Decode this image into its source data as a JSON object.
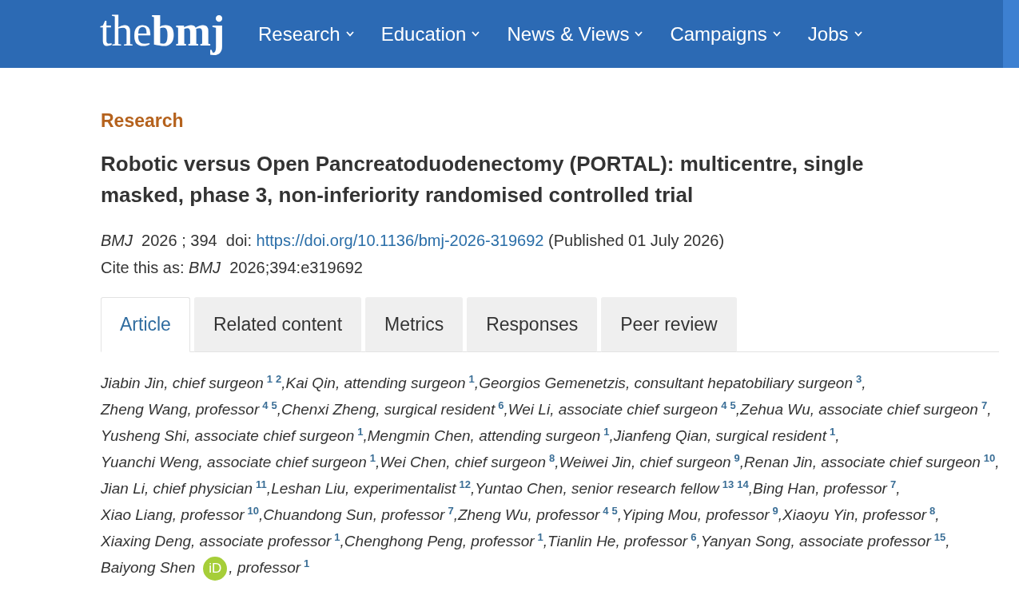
{
  "header": {
    "logo": "the**bmj**",
    "nav": [
      {
        "label": "Research"
      },
      {
        "label": "Education"
      },
      {
        "label": "News & Views"
      },
      {
        "label": "Campaigns"
      },
      {
        "label": "Jobs"
      }
    ]
  },
  "article": {
    "section": "Research",
    "title": "Robotic versus Open Pancreatoduodenectomy (PORTAL): multicentre, single masked, phase 3, non-inferiority randomised controlled trial",
    "citation": {
      "lead": "*BMJ*  2026 ; 394  doi: ",
      "doi_link": "https://doi.org/10.1136/bmj-2026-319692",
      "published": " (Published 01 July 2026)"
    },
    "cite_as": "Cite this as: *BMJ*  2026;394:e319692"
  },
  "tabs": [
    {
      "label": "Article",
      "selected": true
    },
    {
      "label": "Related content",
      "selected": false
    },
    {
      "label": "Metrics",
      "selected": false
    },
    {
      "label": "Responses",
      "selected": false
    },
    {
      "label": "Peer review",
      "selected": false
    }
  ],
  "authors": [
    {
      "name": "Jiabin Jin",
      "role": ", chief surgeon",
      "affiliations": [
        "1",
        "2"
      ],
      "separator": ","
    },
    {
      "name": "Kai Qin",
      "role": ", attending surgeon",
      "affiliations": [
        "1"
      ],
      "separator": ","
    },
    {
      "name": "Georgios Gemenetzis",
      "role": ", consultant hepatobiliary surgeon",
      "affiliations": [
        "3"
      ],
      "separator": ","
    },
    {
      "name": "Zheng Wang",
      "role": ", professor",
      "affiliations": [
        "4",
        "5"
      ],
      "separator": ","
    },
    {
      "name": "Chenxi Zheng",
      "role": ", surgical resident",
      "affiliations": [
        "6"
      ],
      "separator": ","
    },
    {
      "name": "Wei Li",
      "role": ", associate chief surgeon",
      "affiliations": [
        "4",
        "5"
      ],
      "separator": ","
    },
    {
      "name": "Zehua Wu",
      "role": ", associate chief surgeon",
      "affiliations": [
        "7"
      ],
      "separator": ","
    },
    {
      "name": "Yusheng Shi",
      "role": ", associate chief surgeon",
      "affiliations": [
        "1"
      ],
      "separator": ","
    },
    {
      "name": "Mengmin Chen",
      "role": ", attending surgeon",
      "affiliations": [
        "1"
      ],
      "separator": ","
    },
    {
      "name": "Jianfeng Qian",
      "role": ", surgical resident",
      "affiliations": [
        "1"
      ],
      "separator": ","
    },
    {
      "name": "Yuanchi Weng",
      "role": ", associate chief surgeon",
      "affiliations": [
        "1"
      ],
      "separator": ","
    },
    {
      "name": "Wei Chen",
      "role": ", chief surgeon",
      "affiliations": [
        "8"
      ],
      "separator": ","
    },
    {
      "name": "Weiwei Jin",
      "role": ", chief surgeon",
      "affiliations": [
        "9"
      ],
      "separator": ","
    },
    {
      "name": "Renan Jin",
      "role": ", associate chief surgeon",
      "affiliations": [
        "10"
      ],
      "separator": ","
    },
    {
      "name": "Jian Li",
      "role": ", chief physician",
      "affiliations": [
        "11"
      ],
      "separator": ","
    },
    {
      "name": "Leshan Liu",
      "role": ", experimentalist",
      "affiliations": [
        "12"
      ],
      "separator": ","
    },
    {
      "name": "Yuntao Chen",
      "role": ", senior research fellow",
      "affiliations": [
        "13",
        "14"
      ],
      "separator": ","
    },
    {
      "name": "Bing Han",
      "role": ", professor",
      "affiliations": [
        "7"
      ],
      "separator": ","
    },
    {
      "name": "Xiao Liang",
      "role": ", professor",
      "affiliations": [
        "10"
      ],
      "separator": ","
    },
    {
      "name": "Chuandong Sun",
      "role": ", professor",
      "affiliations": [
        "7"
      ],
      "separator": ","
    },
    {
      "name": "Zheng Wu",
      "role": ", professor",
      "affiliations": [
        "4",
        "5"
      ],
      "separator": ","
    },
    {
      "name": "Yiping Mou",
      "role": ", professor",
      "affiliations": [
        "9"
      ],
      "separator": ","
    },
    {
      "name": "Xiaoyu Yin",
      "role": ", professor",
      "affiliations": [
        "8"
      ],
      "separator": ","
    },
    {
      "name": "Xiaxing Deng",
      "role": ", associate professor",
      "affiliations": [
        "1"
      ],
      "separator": ","
    },
    {
      "name": "Chenghong Peng",
      "role": ", professor",
      "affiliations": [
        "1"
      ],
      "separator": ","
    },
    {
      "name": "Tianlin He",
      "role": ", professor",
      "affiliations": [
        "6"
      ],
      "separator": ","
    },
    {
      "name": "Yanyan Song",
      "role": ", associate professor",
      "affiliations": [
        "15"
      ],
      "separator": ","
    },
    {
      "name": "Baiyong Shen",
      "orcid": "iD",
      "role": ", professor",
      "affiliations": [
        "1"
      ]
    }
  ]
}
